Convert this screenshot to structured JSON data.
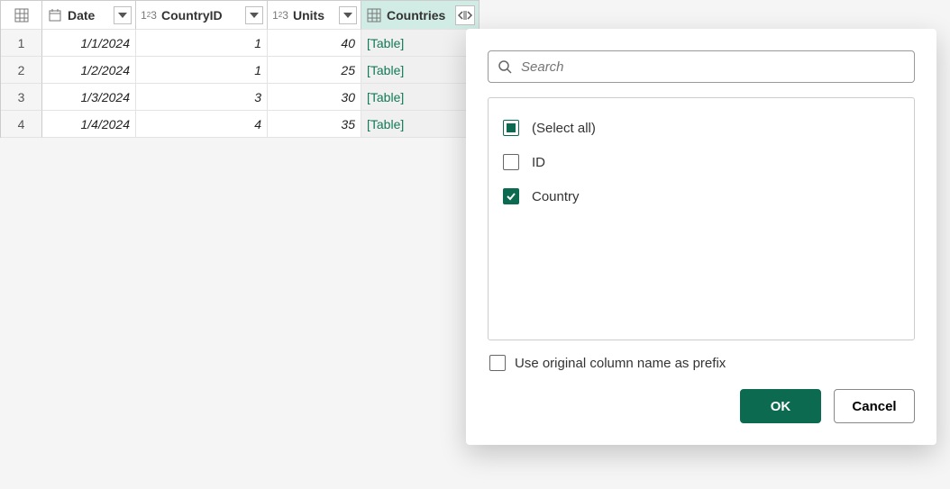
{
  "table": {
    "columns": {
      "date": "Date",
      "countryId": "CountryID",
      "units": "Units",
      "countries": "Countries"
    },
    "rows": [
      {
        "n": "1",
        "date": "1/1/2024",
        "countryId": "1",
        "units": "40",
        "countries": "[Table]"
      },
      {
        "n": "2",
        "date": "1/2/2024",
        "countryId": "1",
        "units": "25",
        "countries": "[Table]"
      },
      {
        "n": "3",
        "date": "1/3/2024",
        "countryId": "3",
        "units": "30",
        "countries": "[Table]"
      },
      {
        "n": "4",
        "date": "1/4/2024",
        "countryId": "4",
        "units": "35",
        "countries": "[Table]"
      }
    ]
  },
  "popup": {
    "search": {
      "placeholder": "Search"
    },
    "items": {
      "selectAll": "(Select all)",
      "id": "ID",
      "country": "Country"
    },
    "state": {
      "selectAll": "indeterminate",
      "id": "unchecked",
      "country": "checked"
    },
    "prefix": {
      "label": "Use original column name as prefix",
      "checked": false
    },
    "buttons": {
      "ok": "OK",
      "cancel": "Cancel"
    }
  },
  "colors": {
    "accent": "#0b6a4f",
    "link": "#117a57",
    "headerSelected": "#d1ece5"
  }
}
